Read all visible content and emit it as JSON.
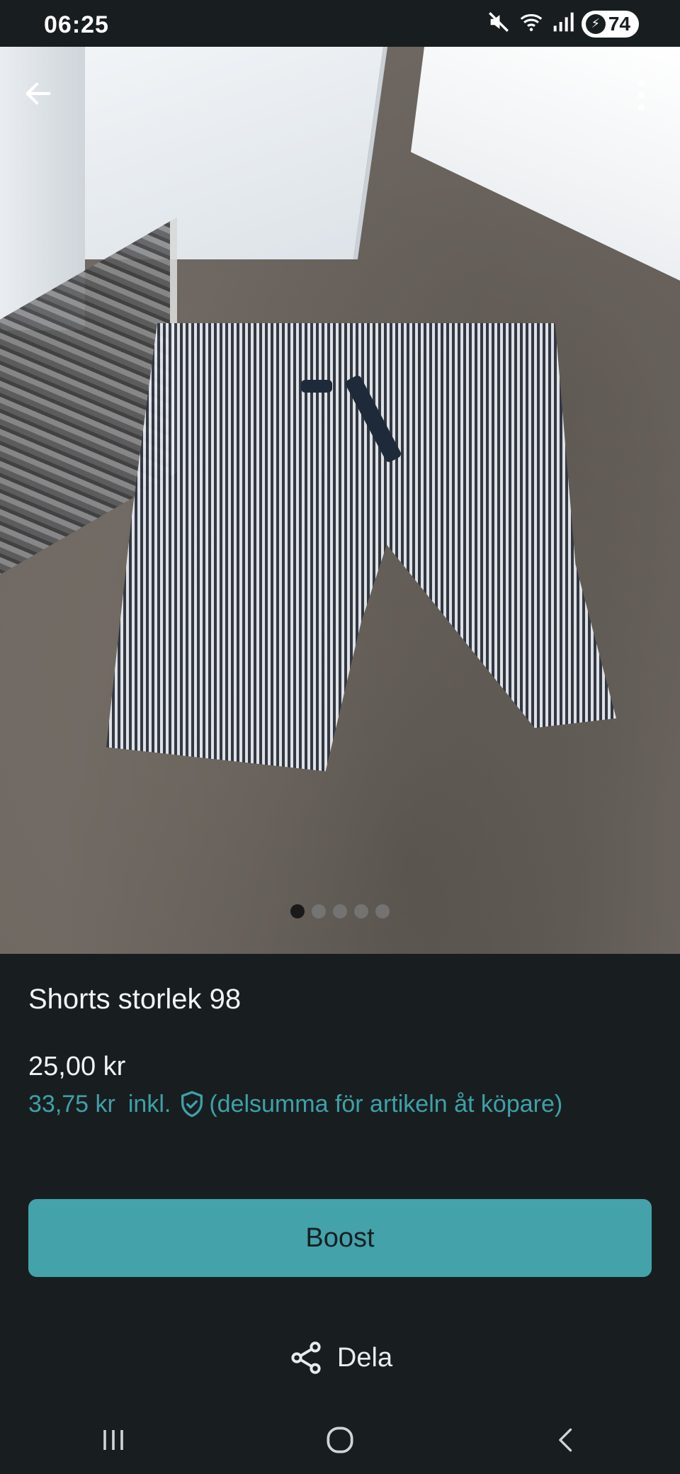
{
  "status_bar": {
    "time": "06:25",
    "battery_level": "74",
    "icons": [
      "mute-icon",
      "wifi-icon",
      "signal-icon",
      "battery-icon"
    ]
  },
  "photo": {
    "image_count": 5,
    "active_index": 0,
    "back_icon": "arrow-left-icon",
    "menu_icon": "more-vertical-icon"
  },
  "listing": {
    "title": "Shorts storlek 98",
    "price": "25,00 kr",
    "price_incl_amount": "33,75 kr",
    "price_incl_label": "inkl.",
    "price_incl_note": "(delsumma för artikeln åt köpare)"
  },
  "actions": {
    "boost_label": "Boost",
    "share_label": "Dela"
  },
  "colors": {
    "background": "#181e20",
    "accent": "#44a2ab",
    "link_text": "#3fa0a8"
  }
}
